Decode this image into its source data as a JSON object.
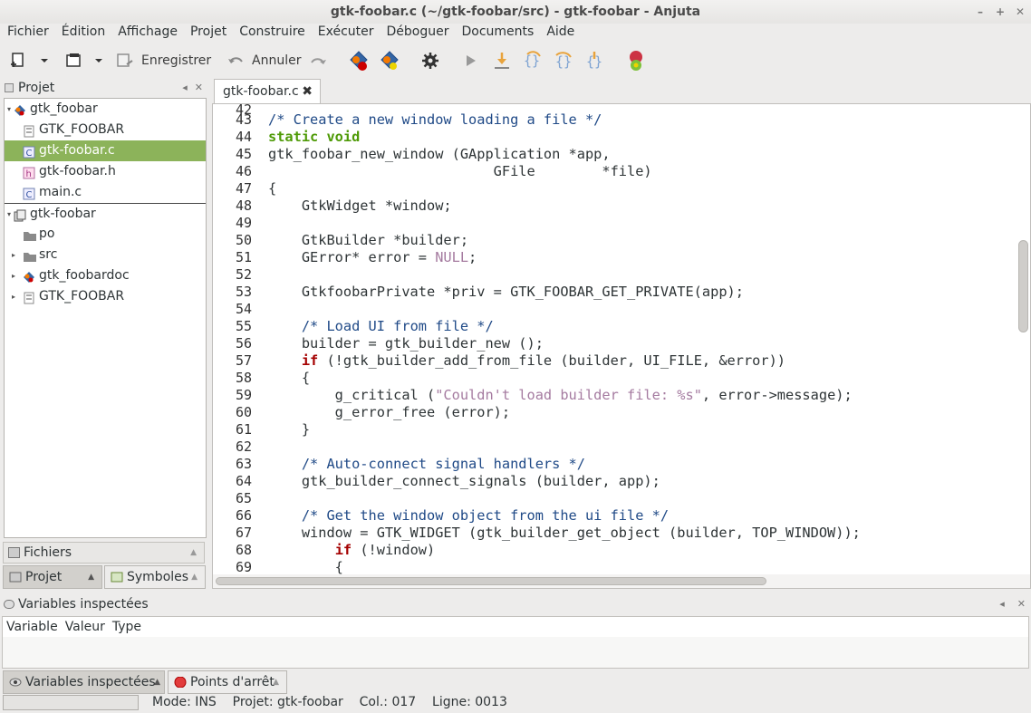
{
  "window": {
    "title": "gtk-foobar.c (~/gtk-foobar/src) - gtk-foobar - Anjuta",
    "controls": [
      "minimize-icon",
      "maximize-icon",
      "close-icon"
    ]
  },
  "menu": [
    "Fichier",
    "Édition",
    "Affichage",
    "Projet",
    "Construire",
    "Exécuter",
    "Déboguer",
    "Documents",
    "Aide"
  ],
  "toolbar": {
    "save_label": "Enregistrer",
    "undo_label": "Annuler"
  },
  "project_panel": {
    "title": "Projet",
    "tree": [
      {
        "label": "gtk_foobar",
        "icon": "target-icon",
        "expander": "▾",
        "indent": 0
      },
      {
        "label": "GTK_FOOBAR",
        "icon": "module-icon",
        "expander": "",
        "indent": 1
      },
      {
        "label": "gtk-foobar.c",
        "icon": "c-source-icon",
        "expander": "",
        "indent": 1,
        "selected": true
      },
      {
        "label": "gtk-foobar.h",
        "icon": "c-header-icon",
        "expander": "",
        "indent": 1
      },
      {
        "label": "main.c",
        "icon": "c-source-icon",
        "expander": "",
        "indent": 1
      },
      {
        "label": "gtk-foobar",
        "icon": "project-icon",
        "expander": "▾",
        "indent": 0,
        "separator": true
      },
      {
        "label": "po",
        "icon": "folder-icon",
        "expander": "",
        "indent": 1
      },
      {
        "label": "src",
        "icon": "folder-icon",
        "expander": "▸",
        "indent": 1
      },
      {
        "label": "gtk_foobardoc",
        "icon": "target-icon",
        "expander": "▸",
        "indent": 1
      },
      {
        "label": "GTK_FOOBAR",
        "icon": "module-icon",
        "expander": "▸",
        "indent": 1
      }
    ],
    "files_tab": "Fichiers",
    "project_tab": "Projet",
    "symbols_tab": "Symboles"
  },
  "editor": {
    "tab_label": "gtk-foobar.c",
    "first_partial_line": "42",
    "lines": [
      {
        "n": "43",
        "html": "<span class=\"cm\">/* Create a new window loading a file */</span>"
      },
      {
        "n": "44",
        "html": "<span class=\"kw\">static void</span>"
      },
      {
        "n": "45",
        "html": "gtk_foobar_new_window (GApplication *app,"
      },
      {
        "n": "46",
        "html": "                           GFile        *file)"
      },
      {
        "n": "47",
        "html": "{"
      },
      {
        "n": "48",
        "html": "    GtkWidget *window;"
      },
      {
        "n": "49",
        "html": ""
      },
      {
        "n": "50",
        "html": "    GtkBuilder *builder;"
      },
      {
        "n": "51",
        "html": "    GError* error = <span class=\"nul\">NULL</span>;"
      },
      {
        "n": "52",
        "html": ""
      },
      {
        "n": "53",
        "html": "    GtkfoobarPrivate *priv = GTK_FOOBAR_GET_PRIVATE(app);"
      },
      {
        "n": "54",
        "html": ""
      },
      {
        "n": "55",
        "html": "    <span class=\"cm\">/* Load UI from file */</span>"
      },
      {
        "n": "56",
        "html": "    builder = gtk_builder_new ();"
      },
      {
        "n": "57",
        "html": "    <span class=\"kwr\">if</span> (!gtk_builder_add_from_file (builder, UI_FILE, &amp;error))"
      },
      {
        "n": "58",
        "html": "    {"
      },
      {
        "n": "59",
        "html": "        g_critical (<span class=\"str\">\"Couldn't load builder file: %s\"</span>, error-&gt;message);"
      },
      {
        "n": "60",
        "html": "        g_error_free (error);"
      },
      {
        "n": "61",
        "html": "    }"
      },
      {
        "n": "62",
        "html": ""
      },
      {
        "n": "63",
        "html": "    <span class=\"cm\">/* Auto-connect signal handlers */</span>"
      },
      {
        "n": "64",
        "html": "    gtk_builder_connect_signals (builder, app);"
      },
      {
        "n": "65",
        "html": ""
      },
      {
        "n": "66",
        "html": "    <span class=\"cm\">/* Get the window object from the ui file */</span>"
      },
      {
        "n": "67",
        "html": "    window = GTK_WIDGET (gtk_builder_get_object (builder, TOP_WINDOW));"
      },
      {
        "n": "68",
        "html": "        <span class=\"kwr\">if</span> (!window)"
      },
      {
        "n": "69",
        "html": "        {"
      }
    ]
  },
  "bottom_panel": {
    "title": "Variables inspectées",
    "columns": [
      "Variable",
      "Valeur",
      "Type"
    ],
    "tab_vars": "Variables inspectées",
    "tab_breakpoints": "Points d'arrêt"
  },
  "status": {
    "mode": "Mode: INS",
    "project": "Projet: gtk-foobar",
    "col": "Col.: 017",
    "line": "Ligne: 0013"
  }
}
